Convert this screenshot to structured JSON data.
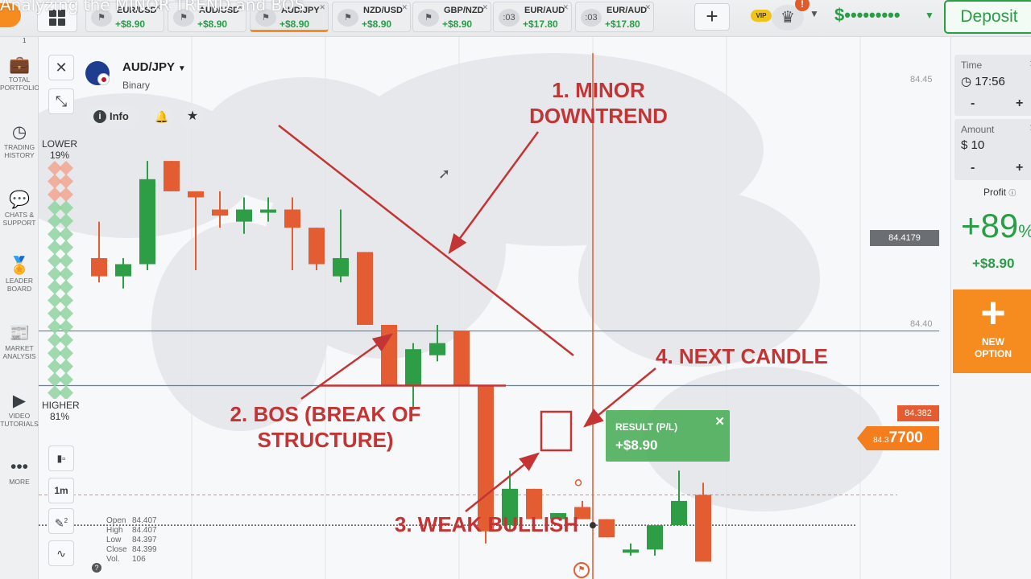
{
  "page_title": "Analyzing the MINOR TREND and BOS",
  "top_bar": {
    "asset_tabs": [
      {
        "name": "EUR/USD",
        "profit": "+$8.90",
        "badge": "",
        "active": false
      },
      {
        "name": "AUD/USD",
        "profit": "+$8.90",
        "badge": "",
        "active": false
      },
      {
        "name": "AUD/JPY",
        "profit": "+$8.90",
        "badge": "",
        "active": true
      },
      {
        "name": "NZD/USD",
        "profit": "+$8.90",
        "badge": "",
        "active": false
      },
      {
        "name": "GBP/NZD",
        "profit": "+$8.90",
        "badge": "",
        "active": false
      },
      {
        "name": "EUR/AUD",
        "profit": "+$17.80",
        "badge": ":03",
        "active": false
      },
      {
        "name": "EUR/AUD",
        "profit": "+$17.80",
        "badge": ":03",
        "active": false
      }
    ],
    "add_tab": "+",
    "vip": "VIP",
    "alert": "!",
    "balance": "$•••••••••",
    "deposit": "Deposit"
  },
  "sidebar": {
    "portfolio_count": "1",
    "items": [
      {
        "label": "TOTAL PORTFOLIO",
        "icon": "briefcase-icon"
      },
      {
        "label": "TRADING HISTORY",
        "icon": "history-icon"
      },
      {
        "label": "CHATS & SUPPORT",
        "icon": "chat-icon"
      },
      {
        "label": "LEADER BOARD",
        "icon": "medal-icon"
      },
      {
        "label": "MARKET ANALYSIS",
        "icon": "news-icon"
      },
      {
        "label": "VIDEO TUTORIALS",
        "icon": "play-icon"
      },
      {
        "label": "MORE",
        "icon": "more-icon"
      }
    ]
  },
  "chart": {
    "asset": "AUD/JPY",
    "asset_type": "Binary",
    "info": "Info",
    "lower_label": "LOWER",
    "lower_pct": "19%",
    "higher_label": "HIGHER",
    "higher_pct": "81%",
    "timeframe": "1m",
    "draw_badge": "2",
    "price_grey": "84.4179",
    "price_red": "84.382",
    "current_price_prefix": "84.3",
    "current_price_main": "7700",
    "axis_top": "84.45",
    "axis_mid": "84.40",
    "ohlc": {
      "open": "84.407",
      "high": "84.407",
      "low": "84.397",
      "close": "84.399",
      "vol": "106"
    },
    "ohlc_labels": {
      "open": "Open",
      "high": "High",
      "low": "Low",
      "close": "Close",
      "vol": "Vol."
    },
    "result_label": "RESULT (P/L)",
    "result_value": "+$8.90",
    "annotations": {
      "minor_downtrend": "1. MINOR\nDOWNTREND",
      "bos": "2. BOS (BREAK OF\nSTRUCTURE)",
      "weak_bullish": "3. WEAK BULLISH",
      "next_candle": "4. NEXT CANDLE"
    },
    "colors": {
      "bull": "#2e9e46",
      "bear": "#e45c32",
      "annotation": "#c53434",
      "level_line": "#4a86c8"
    },
    "candles": [
      {
        "o": 84.421,
        "h": 84.427,
        "l": 84.417,
        "c": 84.418
      },
      {
        "o": 84.418,
        "h": 84.421,
        "l": 84.416,
        "c": 84.42
      },
      {
        "o": 84.42,
        "h": 84.437,
        "l": 84.419,
        "c": 84.434
      },
      {
        "o": 84.437,
        "h": 84.437,
        "l": 84.432,
        "c": 84.432
      },
      {
        "o": 84.432,
        "h": 84.432,
        "l": 84.419,
        "c": 84.431
      },
      {
        "o": 84.429,
        "h": 84.432,
        "l": 84.426,
        "c": 84.428
      },
      {
        "o": 84.427,
        "h": 84.431,
        "l": 84.425,
        "c": 84.429
      },
      {
        "o": 84.429,
        "h": 84.431,
        "l": 84.427,
        "c": 84.429
      },
      {
        "o": 84.429,
        "h": 84.431,
        "l": 84.419,
        "c": 84.426
      },
      {
        "o": 84.426,
        "h": 84.426,
        "l": 84.419,
        "c": 84.42
      },
      {
        "o": 84.418,
        "h": 84.429,
        "l": 84.417,
        "c": 84.421
      },
      {
        "o": 84.422,
        "h": 84.422,
        "l": 84.41,
        "c": 84.41
      },
      {
        "o": 84.41,
        "h": 84.41,
        "l": 84.4,
        "c": 84.4
      },
      {
        "o": 84.4,
        "h": 84.407,
        "l": 84.396,
        "c": 84.406
      },
      {
        "o": 84.405,
        "h": 84.41,
        "l": 84.404,
        "c": 84.407
      },
      {
        "o": 84.409,
        "h": 84.409,
        "l": 84.4,
        "c": 84.4
      },
      {
        "o": 84.4,
        "h": 84.4,
        "l": 84.374,
        "c": 84.376
      },
      {
        "o": 84.377,
        "h": 84.386,
        "l": 84.376,
        "c": 84.383
      },
      {
        "o": 84.383,
        "h": 84.383,
        "l": 84.376,
        "c": 84.378
      },
      {
        "o": 84.378,
        "h": 84.379,
        "l": 84.378,
        "c": 84.379
      },
      {
        "o": 84.38,
        "h": 84.381,
        "l": 84.378,
        "c": 84.378
      },
      {
        "o": 84.378,
        "h": 84.378,
        "l": 84.375,
        "c": 84.375
      },
      {
        "o": 84.373,
        "h": 84.374,
        "l": 84.372,
        "c": 84.373
      },
      {
        "o": 84.373,
        "h": 84.377,
        "l": 84.372,
        "c": 84.377
      },
      {
        "o": 84.377,
        "h": 84.386,
        "l": 84.377,
        "c": 84.381
      },
      {
        "o": 84.382,
        "h": 84.384,
        "l": 84.371,
        "c": 84.371
      }
    ],
    "levels": [
      84.409,
      84.4
    ]
  },
  "right_panel": {
    "time_label": "Time",
    "time_value": "17:56",
    "amount_label": "Amount",
    "amount_value": "$ 10",
    "minus": "-",
    "plus": "+",
    "profit_label": "Profit",
    "profit_pct": "+89",
    "profit_pct_sign": "%",
    "profit_amount": "+$8.90",
    "new_option": "NEW\nOPTION"
  }
}
